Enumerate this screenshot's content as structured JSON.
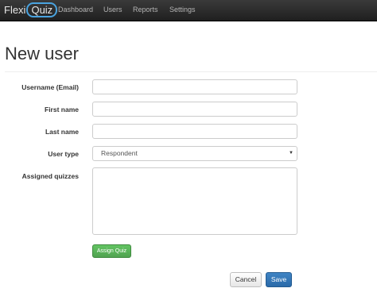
{
  "navbar": {
    "brand_part1": "Flexi",
    "brand_part2": "Quiz",
    "links": [
      "Dashboard",
      "Users",
      "Reports",
      "Settings"
    ]
  },
  "page": {
    "title": "New user"
  },
  "form": {
    "username_label": "Username (Email)",
    "username_value": "",
    "first_name_label": "First name",
    "first_name_value": "",
    "last_name_label": "Last name",
    "last_name_value": "",
    "user_type_label": "User type",
    "user_type_selected": "Respondent",
    "assigned_quizzes_label": "Assigned quizzes",
    "assign_quiz_button": "Assign Quiz"
  },
  "actions": {
    "cancel_label": "Cancel",
    "save_label": "Save"
  },
  "colors": {
    "navbar_bg": "#222222",
    "brand_ring": "#4aa3df",
    "success_green": "#51a351",
    "primary_blue": "#2a6aa9"
  }
}
